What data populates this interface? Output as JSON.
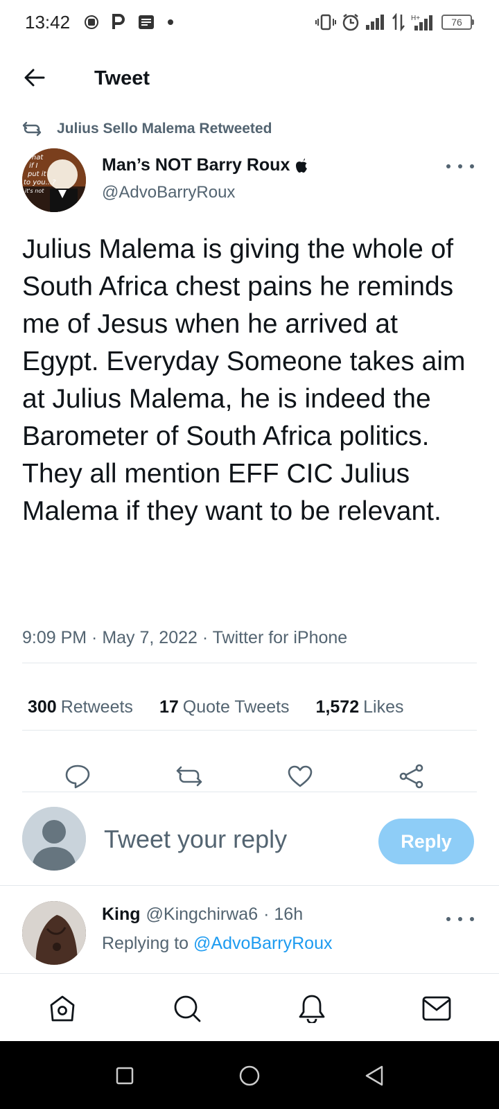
{
  "status_bar": {
    "time": "13:42",
    "battery": "76",
    "network": "H+",
    "left_icons": [
      "b-badge-icon",
      "p-icon",
      "notes-icon",
      "dot-icon"
    ],
    "right_icons": [
      "vibrate-icon",
      "alarm-icon",
      "signal-icon",
      "data-arrows-icon",
      "signal-h-plus-icon",
      "battery-icon"
    ]
  },
  "header": {
    "title": "Tweet",
    "back_icon": "arrow-left-icon"
  },
  "retweet": {
    "label": "Julius Sello Malema Retweeted",
    "icon": "retweet-icon"
  },
  "tweet": {
    "author_name": "Man’s NOT Barry Roux",
    "author_badge_icon": "apple-icon",
    "handle": "@AdvoBarryRoux",
    "avatar_caption": [
      "What",
      "if I",
      "put it",
      "to you...?",
      "it's not"
    ],
    "text": "Julius Malema is giving the whole of South Africa chest pains he reminds me of Jesus when he arrived at Egypt. Everyday Someone takes aim at Julius Malema, he is indeed the Barometer of South Africa politics. They all mention EFF CIC Julius Malema if they want to be relevant.",
    "meta": "9:09 PM · May 7, 2022 · Twitter for iPhone"
  },
  "stats": {
    "retweets_count": "300",
    "retweets_label": "Retweets",
    "quotes_count": "17",
    "quotes_label": "Quote Tweets",
    "likes_count": "1,572",
    "likes_label": "Likes"
  },
  "actions": [
    "reply-icon",
    "retweet-icon",
    "like-icon",
    "share-icon"
  ],
  "reply_composer": {
    "placeholder": "Tweet your reply",
    "button_label": "Reply"
  },
  "reply": {
    "name": "King",
    "handle": "@Kingchirwa6",
    "time": "· 16h",
    "replying_prefix": "Replying to",
    "replying_to": "@AdvoBarryRoux"
  },
  "bottom_nav": [
    "home-icon",
    "search-icon",
    "notifications-icon",
    "messages-icon"
  ],
  "android_nav": [
    "recents-icon",
    "home-circle-icon",
    "back-triangle-icon"
  ],
  "colors": {
    "accent": "#1d9bf0",
    "reply_button": "#8ecdf7",
    "secondary_text": "#536471",
    "divider": "#e3e8ec"
  }
}
